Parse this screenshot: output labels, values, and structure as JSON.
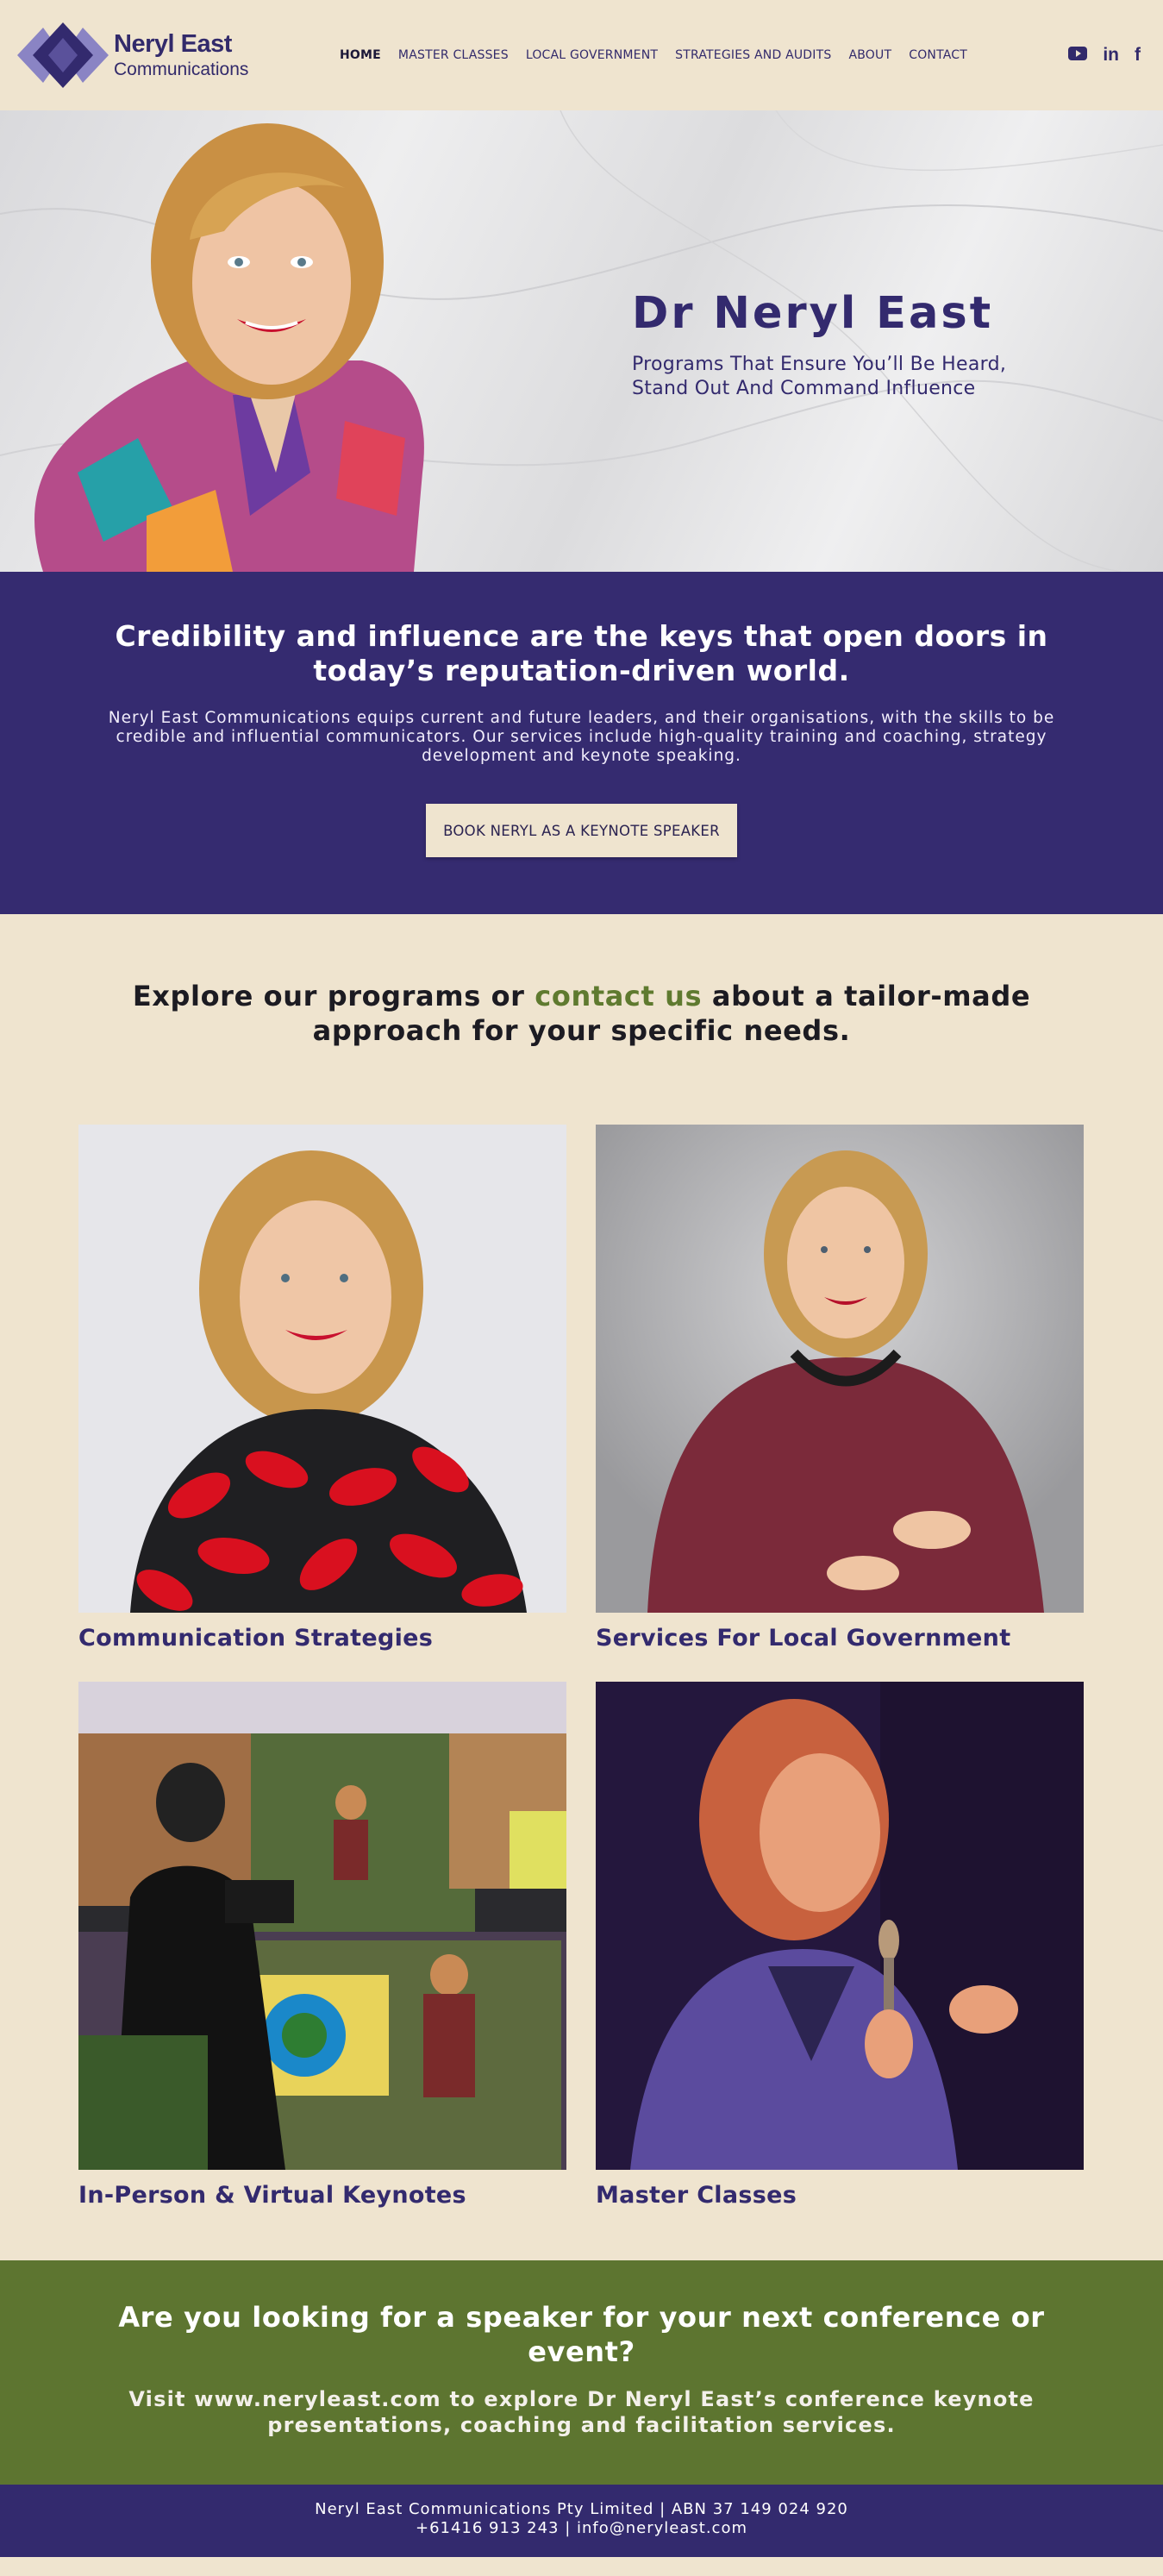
{
  "brand": {
    "name_line1": "Neryl East",
    "name_line2": "Communications",
    "color_primary": "#332a6e",
    "color_cream": "#efe4cf",
    "color_green": "#5d7530"
  },
  "nav": {
    "items": [
      {
        "label": "HOME",
        "active": true
      },
      {
        "label": "MASTER CLASSES"
      },
      {
        "label": "LOCAL GOVERNMENT"
      },
      {
        "label": "STRATEGIES AND AUDITS"
      },
      {
        "label": "ABOUT"
      },
      {
        "label": "CONTACT"
      }
    ]
  },
  "social": {
    "youtube_icon": "youtube-icon",
    "linkedin_label": "in",
    "facebook_label": "f"
  },
  "hero": {
    "title": "Dr Neryl East",
    "subtitle": "Programs That Ensure You’ll Be Heard, Stand Out And Command Influence"
  },
  "band": {
    "title": "Credibility and influence are the keys that open doors in today’s reputation-driven world.",
    "description": "Neryl East Communications equips current and future leaders, and their organisations, with the skills to be credible and influential communicators. Our services include high-quality training and coaching, strategy development and keynote speaking.",
    "button": "BOOK NERYL AS A KEYNOTE SPEAKER"
  },
  "explore": {
    "before": "Explore our programs or ",
    "link": "contact us",
    "after": " about a tailor-made approach for your specific needs."
  },
  "cards": [
    {
      "caption": "Communication Strategies"
    },
    {
      "caption": "Services For Local Government"
    },
    {
      "caption": "In-Person & Virtual Keynotes"
    },
    {
      "caption": "Master Classes"
    }
  ],
  "cta": {
    "title": "Are you looking for a speaker for your next conference or event?",
    "subtitle": "Visit www.neryleast.com to explore Dr Neryl East’s conference keynote presentations, coaching and facilitation services."
  },
  "footer": {
    "line1": "Neryl East Communications Pty Limited | ABN 37 149 024 920",
    "line2": "+61416 913 243 | info@neryleast.com"
  }
}
